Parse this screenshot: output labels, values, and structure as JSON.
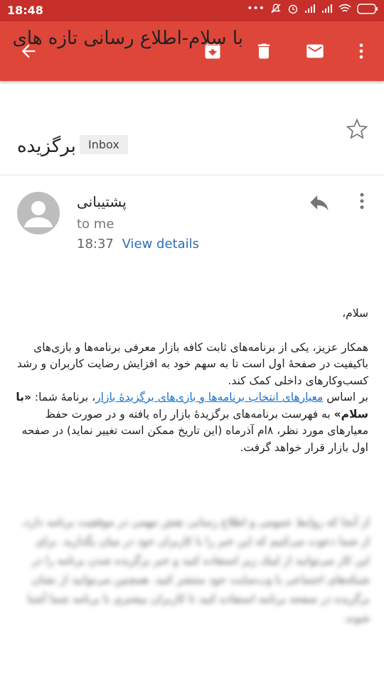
{
  "status_bar": {
    "time": "18:48",
    "icons": [
      "dots-icon",
      "mute-icon",
      "alarm-icon",
      "signal-icon",
      "signal-icon",
      "wifi-icon",
      "battery-icon"
    ]
  },
  "toolbar": {
    "back_icon": "arrow-left-icon",
    "actions": [
      "archive-icon",
      "delete-icon",
      "mail-icon",
      "more-vertical-icon"
    ],
    "color": "#de4639"
  },
  "email": {
    "subject_line1": "با سلام-اطلاع رسانی تازه های",
    "subject_line2": "برگزیده",
    "label": "Inbox",
    "sender": "پشتیبانی",
    "to": "to me",
    "time": "18:37",
    "view_details": "View details",
    "greeting": "سلام،",
    "paragraph1": "همکار عزیز، یکی از برنامه‌های ثابت کافه بازار معرفی برنامه‌ها و بازی‌های باکیفیت در صفحهٔ اول است تا به سهم خود به افزایش رضایت کاربران و رشد کسب‌وکارهای داخلی کمک کند.",
    "para2_prefix": "بر اساس ",
    "para2_link": "معیارهای انتخاب برنامه‌ها و بازی‌های برگزیدهٔ بازار",
    "para2_after_link": "، برنامهٔ شما: ",
    "para2_app": "«با سلام»",
    "para2_suffix": " به فهرست برنامه‌های برگزیدهٔ بازار راه یافته و در صورت حفظ معیارهای مورد نظر، ۸ام آذرماه (این تاریخ ممکن است تغییر نماید) در صفحه اول بازار قرار خواهد گرفت.",
    "blurred_text": "از آنجا که روابط عمومی و اطلاع رسانی نقش مهمی در موفقیت برنامه دارد، از شما دعوت می‌کنیم که این خبر را با کاربران خود در میان بگذارید. برای این کار می‌توانید از لینک زیر استفاده کنید و خبر برگزیده شدن برنامه را در شبکه‌های اجتماعی یا وب‌سایت خود منتشر کنید. همچنین می‌توانید از نشان برگزیده در صفحه برنامه استفاده کنید تا کاربران بیشتری با برنامه شما آشنا شوند."
  }
}
